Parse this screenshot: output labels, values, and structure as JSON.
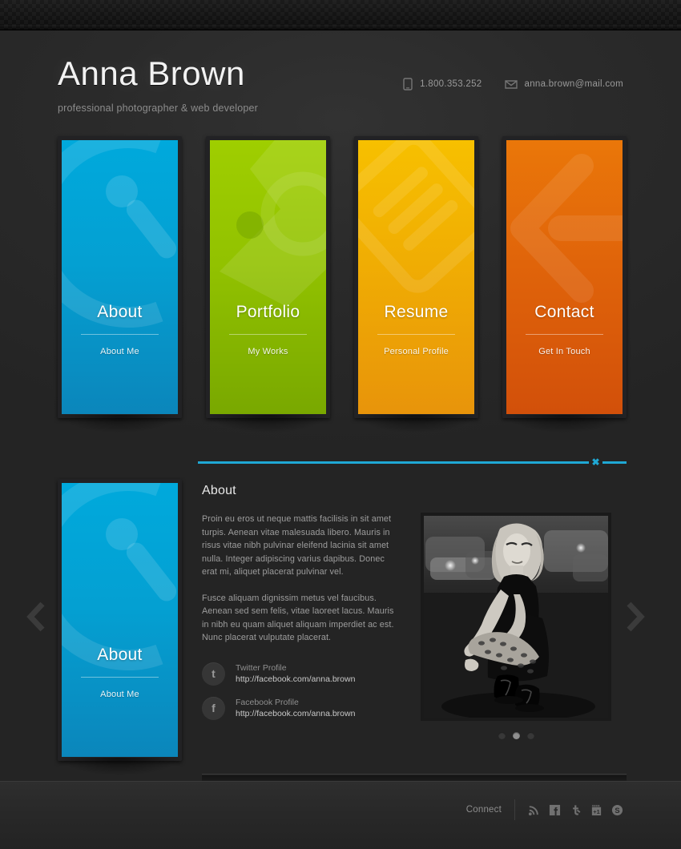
{
  "header": {
    "name": "Anna Brown",
    "tagline": "professional photographer & web developer",
    "phone": "1.800.353.252",
    "email": "anna.brown@mail.com",
    "phone_icon": "phone-icon",
    "email_icon": "envelope-icon"
  },
  "cards": [
    {
      "title": "About",
      "subtitle": "About Me",
      "color_top": "#00a9dc",
      "color_bottom": "#0b86bb",
      "watermark": "camera-lens-icon"
    },
    {
      "title": "Portfolio",
      "subtitle": "My Works",
      "color_top": "#9ccc00",
      "color_bottom": "#79a800",
      "watermark": "tag-label-icon"
    },
    {
      "title": "Resume",
      "subtitle": "Personal Profile",
      "color_top": "#f5bb00",
      "color_bottom": "#e8940a",
      "watermark": "document-lines-icon"
    },
    {
      "title": "Contact",
      "subtitle": "Get In Touch",
      "color_top": "#e8700a",
      "color_bottom": "#d2500a",
      "watermark": "arrow-left-icon"
    }
  ],
  "panel": {
    "accent_color": "#1fa8d4",
    "close_label": "✖",
    "detail_title": "About",
    "paragraphs": [
      "Proin eu eros ut neque mattis facilisis in sit amet turpis. Aenean vitae malesuada libero. Mauris in risus vitae nibh pulvinar eleifend lacinia sit amet nulla. Integer adipiscing varius dapibus. Donec erat mi, aliquet placerat pulvinar vel.",
      "Fusce aliquam dignissim metus vel faucibus. Aenean sed sem felis, vitae laoreet lacus. Mauris in nibh eu quam aliquet aliquam imperdiet ac est. Nunc placerat vulputate placerat."
    ],
    "social": [
      {
        "icon": "twitter-icon",
        "glyph": "t",
        "label": "Twitter Profile",
        "url": "http://facebook.com/anna.brown"
      },
      {
        "icon": "facebook-icon",
        "glyph": "f",
        "label": "Facebook Profile",
        "url": "http://facebook.com/anna.brown"
      }
    ],
    "photo_alt": "black-and-white photo of woman crouching on night street",
    "slider_dots": 3,
    "active_dot": 2,
    "prev_icon": "chevron-left-icon",
    "next_icon": "chevron-right-icon"
  },
  "footer": {
    "connect_label": "Connect",
    "icons": [
      {
        "name": "rss-icon"
      },
      {
        "name": "facebook-icon"
      },
      {
        "name": "twitter-icon"
      },
      {
        "name": "google-plus-icon"
      },
      {
        "name": "skype-icon"
      }
    ]
  }
}
